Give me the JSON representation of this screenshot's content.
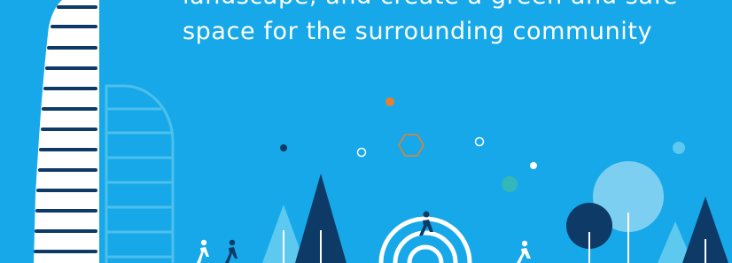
{
  "caption": {
    "line1": "landscape, and create a green and safe",
    "line2": "space for the surrounding community"
  },
  "colors": {
    "background": "#16a8e8",
    "navy": "#0d3a66",
    "light_blue": "#5ec9ef",
    "pale_blue": "#8fd6f3",
    "teal": "#34b7b8",
    "orange": "#e5812c",
    "white": "#ffffff"
  }
}
